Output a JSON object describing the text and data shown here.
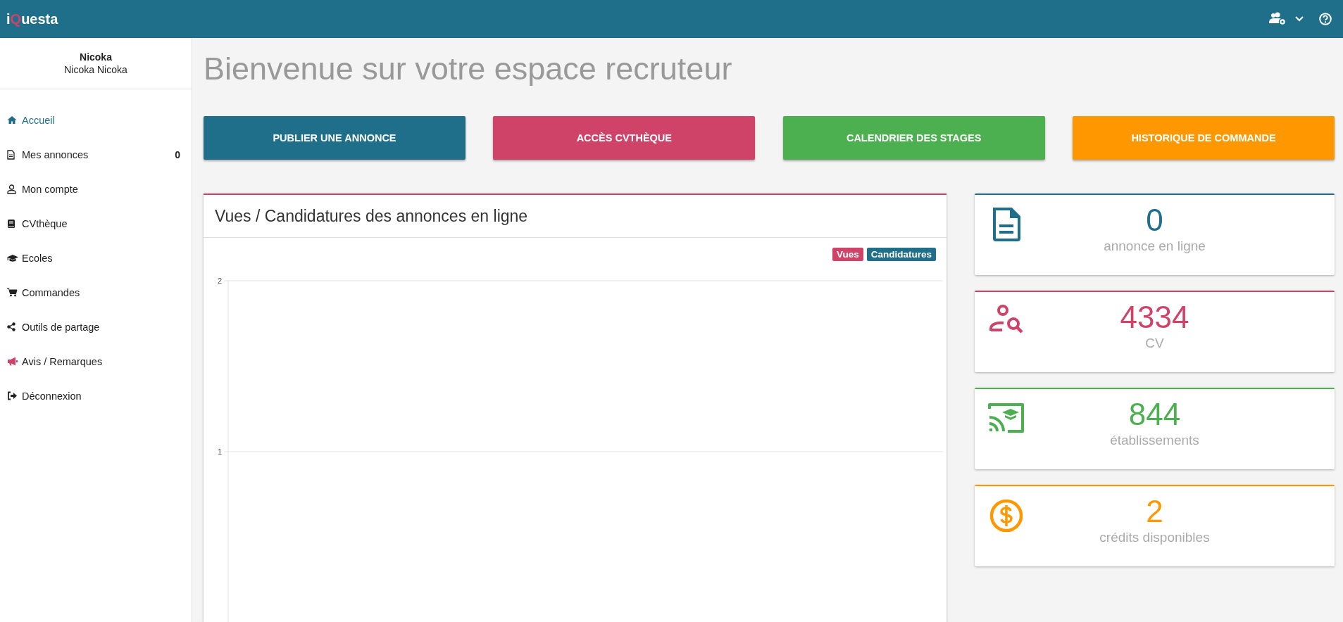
{
  "topbar": {
    "logo": [
      {
        "text": "i",
        "color": "#ffffff"
      },
      {
        "text": "Q",
        "color": "#cf4369"
      },
      {
        "text": "uesta",
        "color": "#ffffff"
      }
    ]
  },
  "sidebar": {
    "user_name": "Nicoka",
    "user_fullname": "Nicoka Nicoka",
    "items": [
      {
        "label": "Accueil",
        "selected": true
      },
      {
        "label": "Mes annonces",
        "selected": false,
        "count": "0"
      },
      {
        "label": "Mon compte",
        "selected": false
      },
      {
        "label": "CVthèque",
        "selected": false
      },
      {
        "label": "Ecoles",
        "selected": false
      },
      {
        "label": "Commandes",
        "selected": false
      },
      {
        "label": "Outils de partage",
        "selected": false
      },
      {
        "label": "Avis / Remarques",
        "selected": false
      },
      {
        "label": "Déconnexion",
        "selected": false
      }
    ]
  },
  "page_title": "Bienvenue sur votre espace recruteur",
  "actions": [
    {
      "label": "PUBLIER UNE ANNONCE",
      "color": "#1f6f8b"
    },
    {
      "label": "ACCÈS CVTHÈQUE",
      "color": "#cf4369"
    },
    {
      "label": "CALENDRIER DES STAGES",
      "color": "#4caf50"
    },
    {
      "label": "HISTORIQUE DE COMMANDE",
      "color": "#ff9800"
    }
  ],
  "chart_card": {
    "title": "Vues / Candidatures des annonces en ligne",
    "chart_data": {
      "type": "line",
      "ylim": [
        0,
        2
      ],
      "yticks": [
        1,
        2
      ],
      "series": [
        {
          "name": "Vues",
          "color": "#cf4369"
        },
        {
          "name": "Candidatures",
          "color": "#1f6f8b"
        }
      ]
    }
  },
  "stats": [
    {
      "value": "0",
      "label": "annonce en ligne",
      "color": "#1f6f8b"
    },
    {
      "value": "4334",
      "label": "CV",
      "color": "#cf4369"
    },
    {
      "value": "844",
      "label": "établissements",
      "color": "#4caf50"
    },
    {
      "value": "2",
      "label": "crédits disponibles",
      "color": "#ff9800"
    }
  ]
}
